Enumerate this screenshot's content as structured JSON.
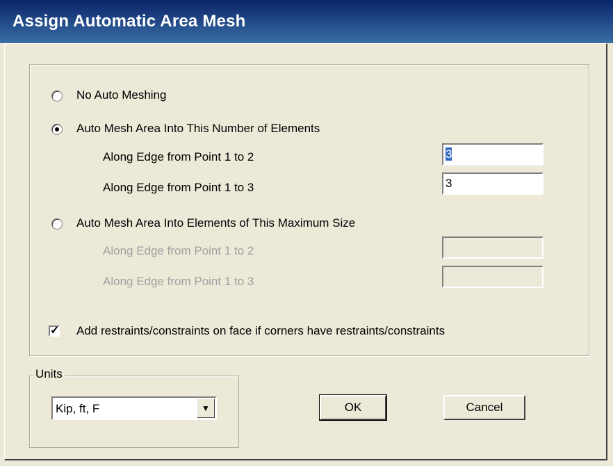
{
  "window": {
    "title": "Assign Automatic Area Mesh"
  },
  "options": {
    "no_auto": "No Auto Meshing",
    "by_number": "Auto Mesh Area Into This Number of Elements",
    "by_size": "Auto Mesh Area Into Elements of This Maximum Size"
  },
  "number_fields": {
    "edge12_label": "Along Edge from Point 1 to 2",
    "edge12_value": "3",
    "edge13_label": "Along Edge from Point 1 to 3",
    "edge13_value": "3"
  },
  "size_fields": {
    "edge12_label": "Along Edge from Point 1 to 2",
    "edge12_value": "",
    "edge13_label": "Along Edge from Point 1 to 3",
    "edge13_value": ""
  },
  "restraints": {
    "label": "Add restraints/constraints on face if corners have restraints/constraints",
    "checked": true
  },
  "units": {
    "legend": "Units",
    "selected": "Kip, ft, F"
  },
  "buttons": {
    "ok": "OK",
    "cancel": "Cancel"
  }
}
